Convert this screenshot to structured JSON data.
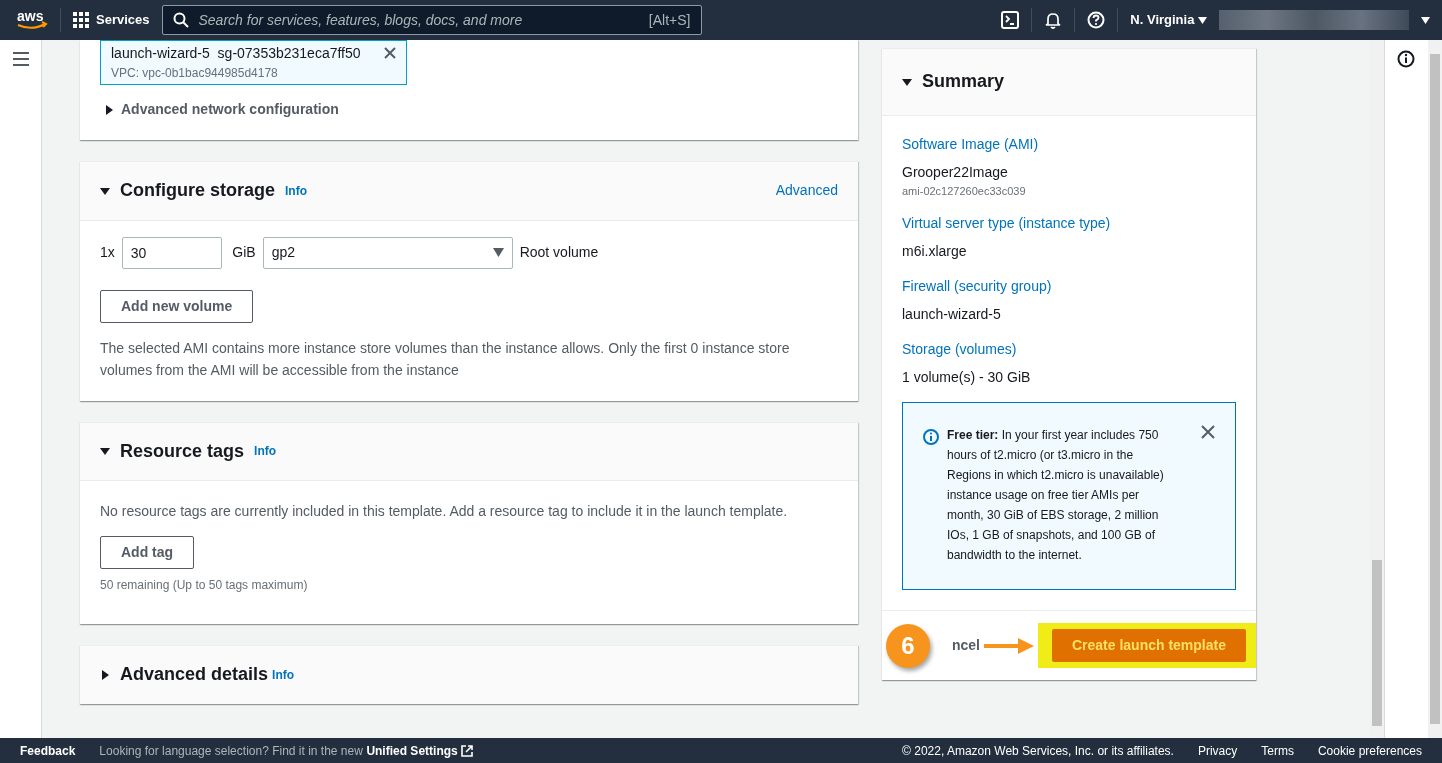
{
  "nav": {
    "logo": "aws",
    "services": "Services",
    "search_placeholder": "Search for services, features, blogs, docs, and more",
    "shortcut": "[Alt+S]",
    "region": "N. Virginia"
  },
  "network": {
    "security_group": {
      "name": "launch-wizard-5",
      "id": "sg-07353b231eca7ff50",
      "vpc": "VPC: vpc-0b1bac944985d4178"
    },
    "advanced": {
      "label": "Advanced network configuration",
      "expanded": false
    }
  },
  "storage": {
    "title": "Configure storage",
    "info": "Info",
    "advanced_link": "Advanced",
    "expanded": true,
    "volume": {
      "count": "1x",
      "size": "30",
      "unit": "GiB",
      "type": "gp2",
      "label": "Root volume"
    },
    "add_button": "Add new volume",
    "note": "The selected AMI contains more instance store volumes than the instance allows. Only the first 0 instance store volumes from the AMI will be accessible from the instance"
  },
  "tags": {
    "title": "Resource tags",
    "info": "Info",
    "expanded": true,
    "note": "No resource tags are currently included in this template. Add a resource tag to include it in the launch template.",
    "add_button": "Add tag",
    "remaining": "50 remaining (Up to 50 tags maximum)"
  },
  "advanced_details": {
    "title": "Advanced details",
    "info": "Info",
    "expanded": false
  },
  "summary": {
    "title": "Summary",
    "expanded": true,
    "items": [
      {
        "label": "Software Image (AMI)",
        "value": "Grooper22Image",
        "sub": "ami-02c127260ec33c039"
      },
      {
        "label": "Virtual server type (instance type)",
        "value": "m6i.xlarge"
      },
      {
        "label": "Firewall (security group)",
        "value": "launch-wizard-5"
      },
      {
        "label": "Storage (volumes)",
        "value": "1 volume(s) - 30 GiB"
      }
    ],
    "alert": "**Free tier:** In your first year includes 750 hours of t2.micro (or t3.micro in the Regions in which t2.micro is unavailable) instance usage on free tier AMIs per month, 30 GiB of EBS storage, 2 million IOs, 1 GB of snapshots, and 100 GB of bandwidth to the internet.",
    "cancel": "ncel",
    "create": "Create launch template"
  },
  "annotation": {
    "step": "6"
  },
  "footer": {
    "feedback": "Feedback",
    "language_note": "Looking for language selection? Find it in the new",
    "settings_link": "Unified Settings",
    "copyright": "© 2022, Amazon Web Services, Inc. or its affiliates.",
    "links": [
      "Privacy",
      "Terms",
      "Cookie preferences"
    ]
  }
}
